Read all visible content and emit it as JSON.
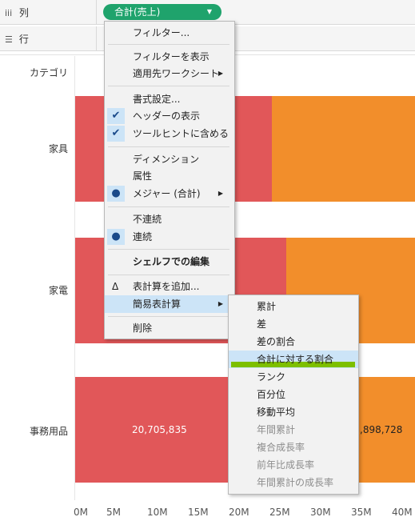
{
  "shelves": {
    "columns_icon": "iii",
    "columns_label": "列",
    "rows_icon": "list-icon",
    "rows_label": "行",
    "pill_label": "合計(売上)"
  },
  "view": {
    "category_header": "カテゴリ",
    "rows": [
      {
        "label": "家具"
      },
      {
        "label": "家電"
      },
      {
        "label": "事務用品",
        "value_label_left": "20,705,835",
        "value_label_right": ",898,728"
      }
    ],
    "axis_ticks": [
      "0M",
      "5M",
      "10M",
      "15M",
      "20M",
      "25M",
      "30M",
      "35M",
      "40M"
    ]
  },
  "context_menu": {
    "items": [
      {
        "label": "フィルター..."
      },
      {
        "label": "フィルターを表示"
      },
      {
        "label": "適用先ワークシート"
      },
      {
        "label": "書式設定..."
      },
      {
        "label": "ヘッダーの表示"
      },
      {
        "label": "ツールヒントに含める"
      },
      {
        "label": "ディメンション"
      },
      {
        "label": "属性"
      },
      {
        "label": "メジャー (合計)"
      },
      {
        "label": "不連続"
      },
      {
        "label": "連続"
      },
      {
        "label": "シェルフでの編集"
      },
      {
        "label": "表計算を追加..."
      },
      {
        "label": "簡易表計算"
      },
      {
        "label": "削除"
      }
    ]
  },
  "submenu": {
    "items": [
      {
        "label": "累計"
      },
      {
        "label": "差"
      },
      {
        "label": "差の割合"
      },
      {
        "label": "合計に対する割合"
      },
      {
        "label": "ランク"
      },
      {
        "label": "百分位"
      },
      {
        "label": "移動平均"
      },
      {
        "label": "年間累計"
      },
      {
        "label": "複合成長率"
      },
      {
        "label": "前年比成長率"
      },
      {
        "label": "年間累計の成長率"
      }
    ]
  },
  "colors": {
    "pill": "#1fa36c",
    "bar_red": "#e15759",
    "bar_orange": "#f28e2b",
    "menu_bg": "#f2f2f2",
    "selection": "#cce4f7",
    "highlight": "#7dbf00"
  }
}
